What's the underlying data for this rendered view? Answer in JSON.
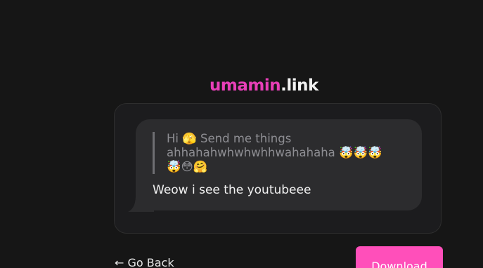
{
  "logo": {
    "main": "umamin",
    "suffix": ".link"
  },
  "message_card": {
    "quote_text": "Hi 🫣 Send me things ahhahahwhwhwhhwahahaha 🤯🤯🤯🤯😳🤗",
    "reply_text": "Weow i see the youtubeee"
  },
  "actions": {
    "back_label": "← Go Back",
    "download_label": "Download"
  },
  "colors": {
    "background": "#161616",
    "accent": "#e83fb8",
    "button": "#ff4fba",
    "bubble": "#2c2c2e"
  }
}
